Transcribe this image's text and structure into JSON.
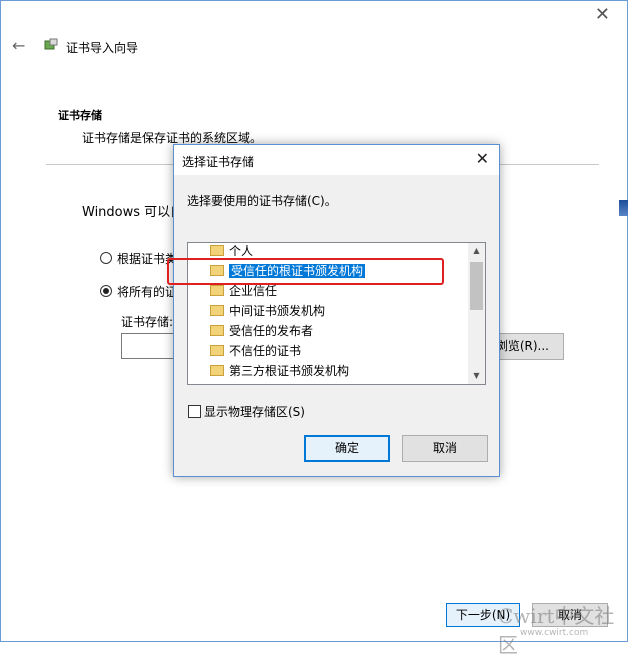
{
  "wizard": {
    "title": "证书导入向导",
    "section_title": "证书存储",
    "section_desc": "证书存储是保存证书的系统区域。",
    "windows_text": "Windows 可以自",
    "radio_auto_label": "根据证书类",
    "radio_manual_label": "将所有的证",
    "store_label": "证书存储:",
    "store_value": "",
    "browse_label": "浏览(R)...",
    "next_label": "下一步(N)",
    "cancel_label": "取消"
  },
  "dialog": {
    "title": "选择证书存储",
    "prompt": "选择要使用的证书存储(C)。",
    "items": [
      {
        "label": "个人",
        "selected": false
      },
      {
        "label": "受信任的根证书颁发机构",
        "selected": true
      },
      {
        "label": "企业信任",
        "selected": false
      },
      {
        "label": "中间证书颁发机构",
        "selected": false
      },
      {
        "label": "受信任的发布者",
        "selected": false
      },
      {
        "label": "不信任的证书",
        "selected": false
      },
      {
        "label": "第三方根证书颁发机构",
        "selected": false
      }
    ],
    "show_physical_label": "显示物理存储区(S)",
    "ok_label": "确定",
    "cancel_label": "取消"
  },
  "watermark": {
    "text": "Cwirt中文社区",
    "sub": "www.cwirt.com"
  },
  "colors": {
    "accent": "#0078d7",
    "highlight_box": "#e02020",
    "folder": "#f3d37a"
  }
}
